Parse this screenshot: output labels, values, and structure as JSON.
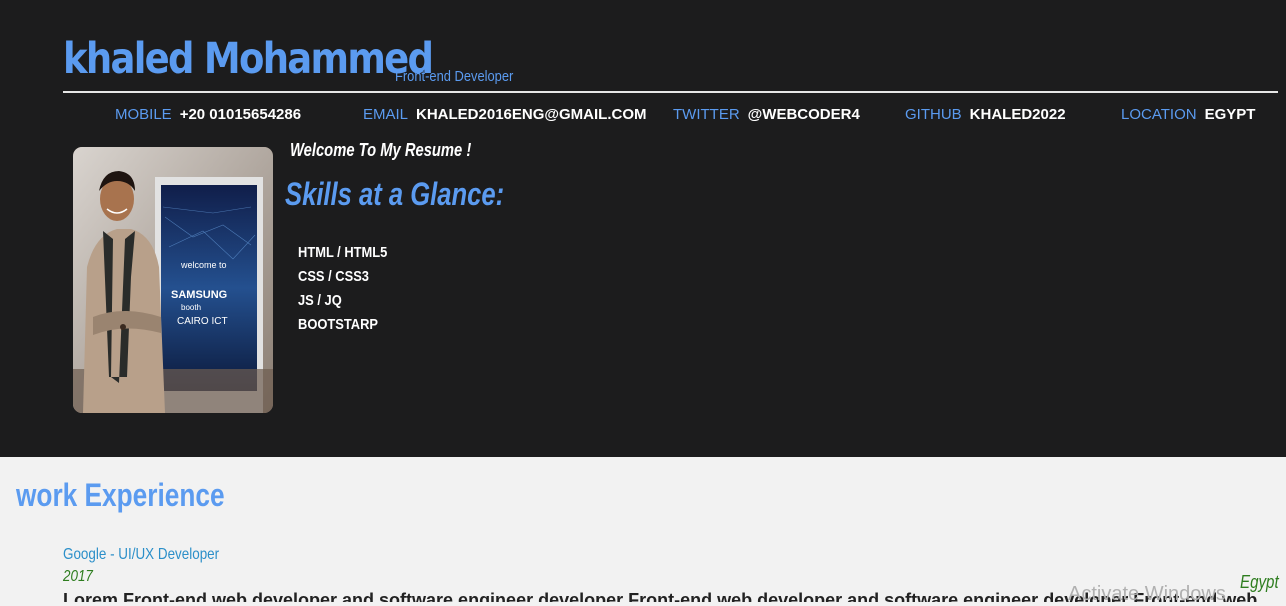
{
  "header": {
    "name": "khaled Mohammed",
    "role": "Front-end Developer"
  },
  "contacts": [
    {
      "label": "MOBILE",
      "value": "+20 01015654286"
    },
    {
      "label": "EMAIL",
      "value": "KHALED2016ENG@GMAIL.COM"
    },
    {
      "label": "TWITTER",
      "value": "@WEBCODER4"
    },
    {
      "label": "GITHUB",
      "value": "KHALED2022"
    },
    {
      "label": "LOCATION",
      "value": "EGYPT"
    }
  ],
  "profile": {
    "welcome": "Welcome To My Resume !",
    "skills_title": "Skills at a Glance:",
    "skills": [
      "HTML / HTML5",
      "CSS / CSS3",
      "JS / JQ",
      "BOOTSTARP"
    ],
    "photo_text": {
      "line1": "welcome to",
      "line2": "SAMSUNG",
      "line3": "booth",
      "line4": "CAIRO ICT"
    }
  },
  "work": {
    "title": "work Experience",
    "job_title": "Google - UI/UX Developer",
    "job_year": "2017",
    "job_location": "Egypt",
    "job_description": "Lorem Front-end web developer and software engineer developer Front-end web developer and software engineer developer Front-end web developer"
  },
  "overlay": {
    "watermark": "Activate Windows"
  },
  "colors": {
    "accent": "#5b9bf0",
    "hero_bg": "#1c1c1d",
    "page_bg": "#f2f2f2",
    "job_title": "#2b8fc9",
    "green": "#2e7d1f"
  }
}
